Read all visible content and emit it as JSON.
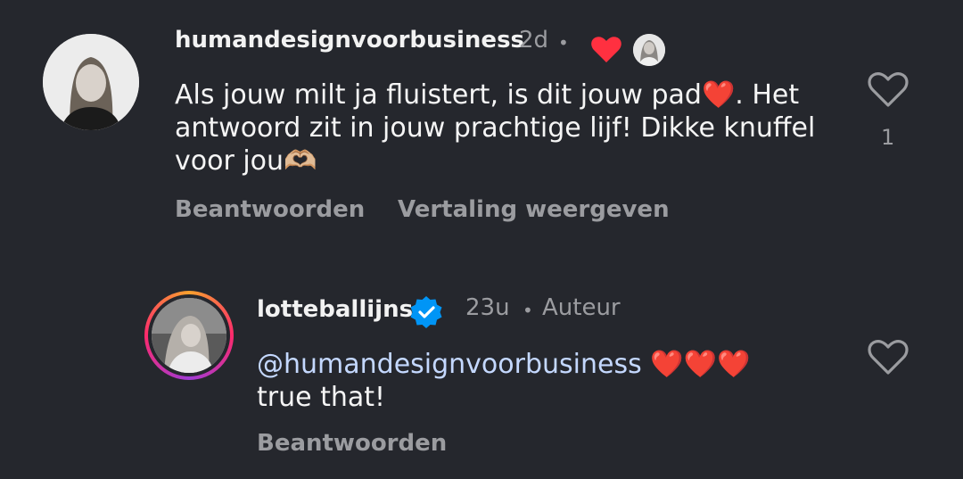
{
  "colors": {
    "background": "#25272d",
    "heart_red": "#ff3040",
    "verified_blue": "#0095f6",
    "mention": "#c4d8ff",
    "muted": "#9b9ca0"
  },
  "comments": [
    {
      "username": "humandesignvoorbusiness",
      "time": "2d",
      "separator": "•",
      "text_parts": [
        "Als jouw milt ja fluistert, is dit jouw pad",
        "❤️",
        ". Het antwoord zit in jouw prachtige lijf! Dikke knuffel voor jou",
        "🫶🏼"
      ],
      "reply_label": "Beantwoorden",
      "translate_label": "Vertaling weergeven",
      "like_count": "1",
      "icons": [
        "heart-outline-icon",
        "author-liked-heart-icon"
      ]
    },
    {
      "username": "lotteballijns",
      "verified": true,
      "time": "23u",
      "separator": "•",
      "badge": "Auteur",
      "mention": "@humandesignvoorbusiness",
      "emoji": "❤️❤️❤️",
      "text": "true that!",
      "reply_label": "Beantwoorden",
      "icons": [
        "heart-outline-icon",
        "verified-icon"
      ]
    }
  ]
}
